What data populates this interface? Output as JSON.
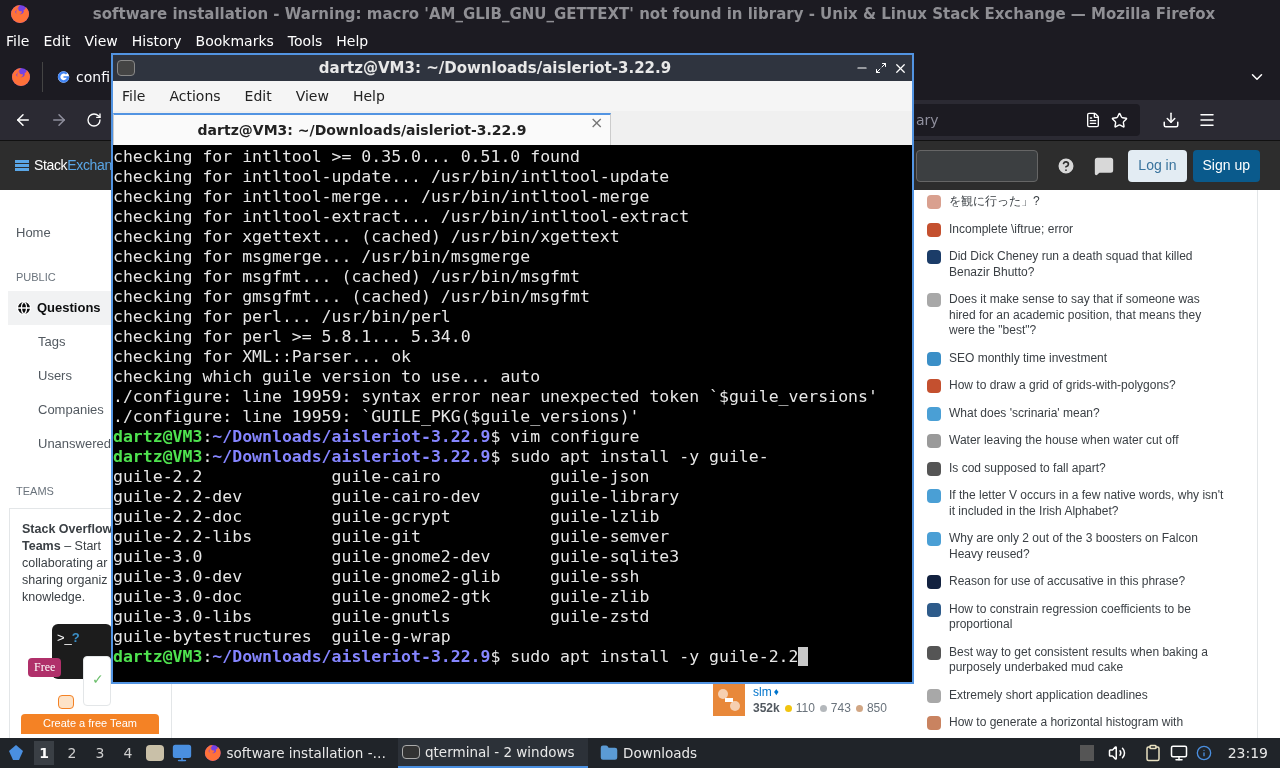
{
  "browser": {
    "title": "software installation - Warning: macro 'AM_GLIB_GNU_GETTEXT' not found in library - Unix & Linux Stack Exchange — Mozilla Firefox",
    "menu": [
      "File",
      "Edit",
      "View",
      "History",
      "Bookmarks",
      "Tools",
      "Help"
    ],
    "tab": {
      "label": "confi"
    },
    "address": {
      "value": "ary"
    }
  },
  "site_header": {
    "logo_first": "Stack",
    "logo_second": "Exchan",
    "login": "Log in",
    "signup": "Sign up"
  },
  "sidebar": {
    "home": "Home",
    "public_heading": "PUBLIC",
    "items": [
      {
        "label": "Questions",
        "selected": true
      },
      {
        "label": "Tags",
        "selected": false
      },
      {
        "label": "Users",
        "selected": false
      },
      {
        "label": "Companies",
        "selected": false
      },
      {
        "label": "Unanswered",
        "selected": false
      }
    ],
    "teams_heading": "TEAMS",
    "teams_lines": [
      "**Stack Overflow**",
      "**Teams** – Start",
      "collaborating ar",
      "sharing organiz",
      "knowledge."
    ],
    "prompt_glyph": ">_",
    "prompt_mark": "?",
    "free_badge": "Free",
    "vote_check": "✓",
    "create_button": "Create a free Team"
  },
  "user_card": {
    "name": "slm",
    "diamond": "♦",
    "reputation": "352k",
    "badges": [
      {
        "count": "110",
        "color": "#f1c40f"
      },
      {
        "count": "743",
        "color": "#b4b8bc"
      },
      {
        "count": "850",
        "color": "#d1a684"
      }
    ]
  },
  "hot_questions": [
    {
      "title": "を観に行った」?",
      "color": "#d9a08f"
    },
    {
      "title": "Incomplete \\iftrue; error",
      "color": "#c4502f"
    },
    {
      "title": "Did Dick Cheney run a death squad that killed Benazir Bhutto?",
      "color": "#1b3c68"
    },
    {
      "title": "Does it make sense to say that if someone was hired for an academic position, that means they were the \"best\"?",
      "color": "#a8a8a8"
    },
    {
      "title": "SEO monthly time investment",
      "color": "#3b8fc7"
    },
    {
      "title": "How to draw a grid of grids-with-polygons?",
      "color": "#c4502f"
    },
    {
      "title": "What does 'scrinaria' mean?",
      "color": "#4a9fd5"
    },
    {
      "title": "Water leaving the house when water cut off",
      "color": "#9a9a9a"
    },
    {
      "title": "Is cod supposed to fall apart?",
      "color": "#555555"
    },
    {
      "title": "If the letter V occurs in a few native words, why isn't it included in the Irish Alphabet?",
      "color": "#4a9fd5"
    },
    {
      "title": "Why are only 2 out of the 3 boosters on Falcon Heavy reused?",
      "color": "#4a9fd5"
    },
    {
      "title": "Reason for use of accusative in this phrase?",
      "color": "#12213f"
    },
    {
      "title": "How to constrain regression coefficients to be proportional",
      "color": "#2e5b8a"
    },
    {
      "title": "Best way to get consistent results when baking a purposely underbaked mud cake",
      "color": "#555555"
    },
    {
      "title": "Extremely short application deadlines",
      "color": "#a8a8a8"
    },
    {
      "title": "How to generate a horizontal histogram with",
      "color": "#c98360"
    }
  ],
  "terminal": {
    "title": "dartz@VM3: ~/Downloads/aisleriot-3.22.9",
    "menu": [
      "File",
      "Actions",
      "Edit",
      "View",
      "Help"
    ],
    "tab": {
      "label": "dartz@VM3: ~/Downloads/aisleriot-3.22.9",
      "close": "×"
    },
    "lines": [
      {
        "kind": "output",
        "text": "checking for intltool >= 0.35.0... 0.51.0 found"
      },
      {
        "kind": "output",
        "text": "checking for intltool-update... /usr/bin/intltool-update"
      },
      {
        "kind": "output",
        "text": "checking for intltool-merge... /usr/bin/intltool-merge"
      },
      {
        "kind": "output",
        "text": "checking for intltool-extract... /usr/bin/intltool-extract"
      },
      {
        "kind": "output",
        "text": "checking for xgettext... (cached) /usr/bin/xgettext"
      },
      {
        "kind": "output",
        "text": "checking for msgmerge... /usr/bin/msgmerge"
      },
      {
        "kind": "output",
        "text": "checking for msgfmt... (cached) /usr/bin/msgfmt"
      },
      {
        "kind": "output",
        "text": "checking for gmsgfmt... (cached) /usr/bin/msgfmt"
      },
      {
        "kind": "output",
        "text": "checking for perl... /usr/bin/perl"
      },
      {
        "kind": "output",
        "text": "checking for perl >= 5.8.1... 5.34.0"
      },
      {
        "kind": "output",
        "text": "checking for XML::Parser... ok"
      },
      {
        "kind": "output",
        "text": "checking which guile version to use... auto"
      },
      {
        "kind": "output",
        "text": "./configure: line 19959: syntax error near unexpected token `$guile_versions'"
      },
      {
        "kind": "output",
        "text": "./configure: line 19959: `GUILE_PKG($guile_versions)'"
      },
      {
        "kind": "prompt",
        "user": "dartz@VM3",
        "path": "~/Downloads/aisleriot-3.22.9",
        "sep": ":",
        "sign": "$",
        "command": "vim configure",
        "cursor": false
      },
      {
        "kind": "prompt",
        "user": "dartz@VM3",
        "path": "~/Downloads/aisleriot-3.22.9",
        "sep": ":",
        "sign": "$",
        "command": "sudo apt install -y guile-",
        "cursor": false
      },
      {
        "kind": "columns",
        "cells": [
          "guile-2.2",
          "guile-cairo",
          "guile-json"
        ]
      },
      {
        "kind": "columns",
        "cells": [
          "guile-2.2-dev",
          "guile-cairo-dev",
          "guile-library"
        ]
      },
      {
        "kind": "columns",
        "cells": [
          "guile-2.2-doc",
          "guile-gcrypt",
          "guile-lzlib"
        ]
      },
      {
        "kind": "columns",
        "cells": [
          "guile-2.2-libs",
          "guile-git",
          "guile-semver"
        ]
      },
      {
        "kind": "columns",
        "cells": [
          "guile-3.0",
          "guile-gnome2-dev",
          "guile-sqlite3"
        ]
      },
      {
        "kind": "columns",
        "cells": [
          "guile-3.0-dev",
          "guile-gnome2-glib",
          "guile-ssh"
        ]
      },
      {
        "kind": "columns",
        "cells": [
          "guile-3.0-doc",
          "guile-gnome2-gtk",
          "guile-zlib"
        ]
      },
      {
        "kind": "columns",
        "cells": [
          "guile-3.0-libs",
          "guile-gnutls",
          "guile-zstd"
        ]
      },
      {
        "kind": "columns",
        "cells": [
          "guile-bytestructures",
          "guile-g-wrap"
        ]
      },
      {
        "kind": "prompt",
        "user": "dartz@VM3",
        "path": "~/Downloads/aisleriot-3.22.9",
        "sep": ":",
        "sign": "$",
        "command": "sudo apt install -y guile-2.2",
        "cursor": true
      }
    ]
  },
  "taskbar": {
    "workspaces": [
      {
        "label": "1",
        "selected": true
      },
      {
        "label": "2",
        "selected": false
      },
      {
        "label": "3",
        "selected": false
      },
      {
        "label": "4",
        "selected": false
      }
    ],
    "tasks": [
      {
        "label": "software installation -…",
        "kind": "browser",
        "selected": false
      },
      {
        "label": "qterminal - 2 windows",
        "kind": "terminal",
        "selected": true
      },
      {
        "label": "Downloads",
        "kind": "folder",
        "selected": false
      }
    ],
    "clock": "23:19"
  }
}
